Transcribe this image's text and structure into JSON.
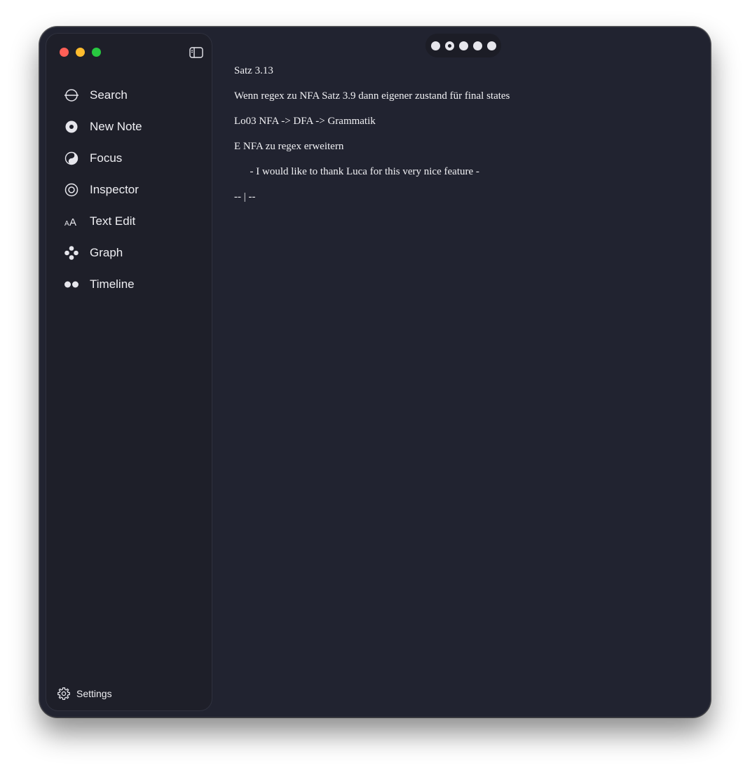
{
  "window": {
    "traffic_lights": [
      "close",
      "minimize",
      "zoom"
    ]
  },
  "sidebar": {
    "toggle_icon": "sidebar-toggle-icon",
    "items": [
      {
        "label": "Search",
        "icon": "search-icon"
      },
      {
        "label": "New Note",
        "icon": "new-note-icon"
      },
      {
        "label": "Focus",
        "icon": "focus-icon"
      },
      {
        "label": "Inspector",
        "icon": "inspector-icon"
      },
      {
        "label": "Text Edit",
        "icon": "text-edit-icon"
      },
      {
        "label": "Graph",
        "icon": "graph-icon"
      },
      {
        "label": "Timeline",
        "icon": "timeline-icon"
      }
    ],
    "settings_label": "Settings"
  },
  "pager": {
    "count": 5,
    "active_index": 1
  },
  "editor": {
    "lines": [
      "Satz 3.13",
      "Wenn regex zu NFA Satz 3.9 dann eigener zustand für final states",
      "Lo03 NFA -> DFA -> Grammatik",
      "E NFA zu regex erweitern",
      "      - I would like to thank Luca for this very nice feature -",
      "-- | --"
    ]
  },
  "colors": {
    "background": "#212330",
    "sidebar": "#1e1f29",
    "text": "#f1f1f4"
  }
}
